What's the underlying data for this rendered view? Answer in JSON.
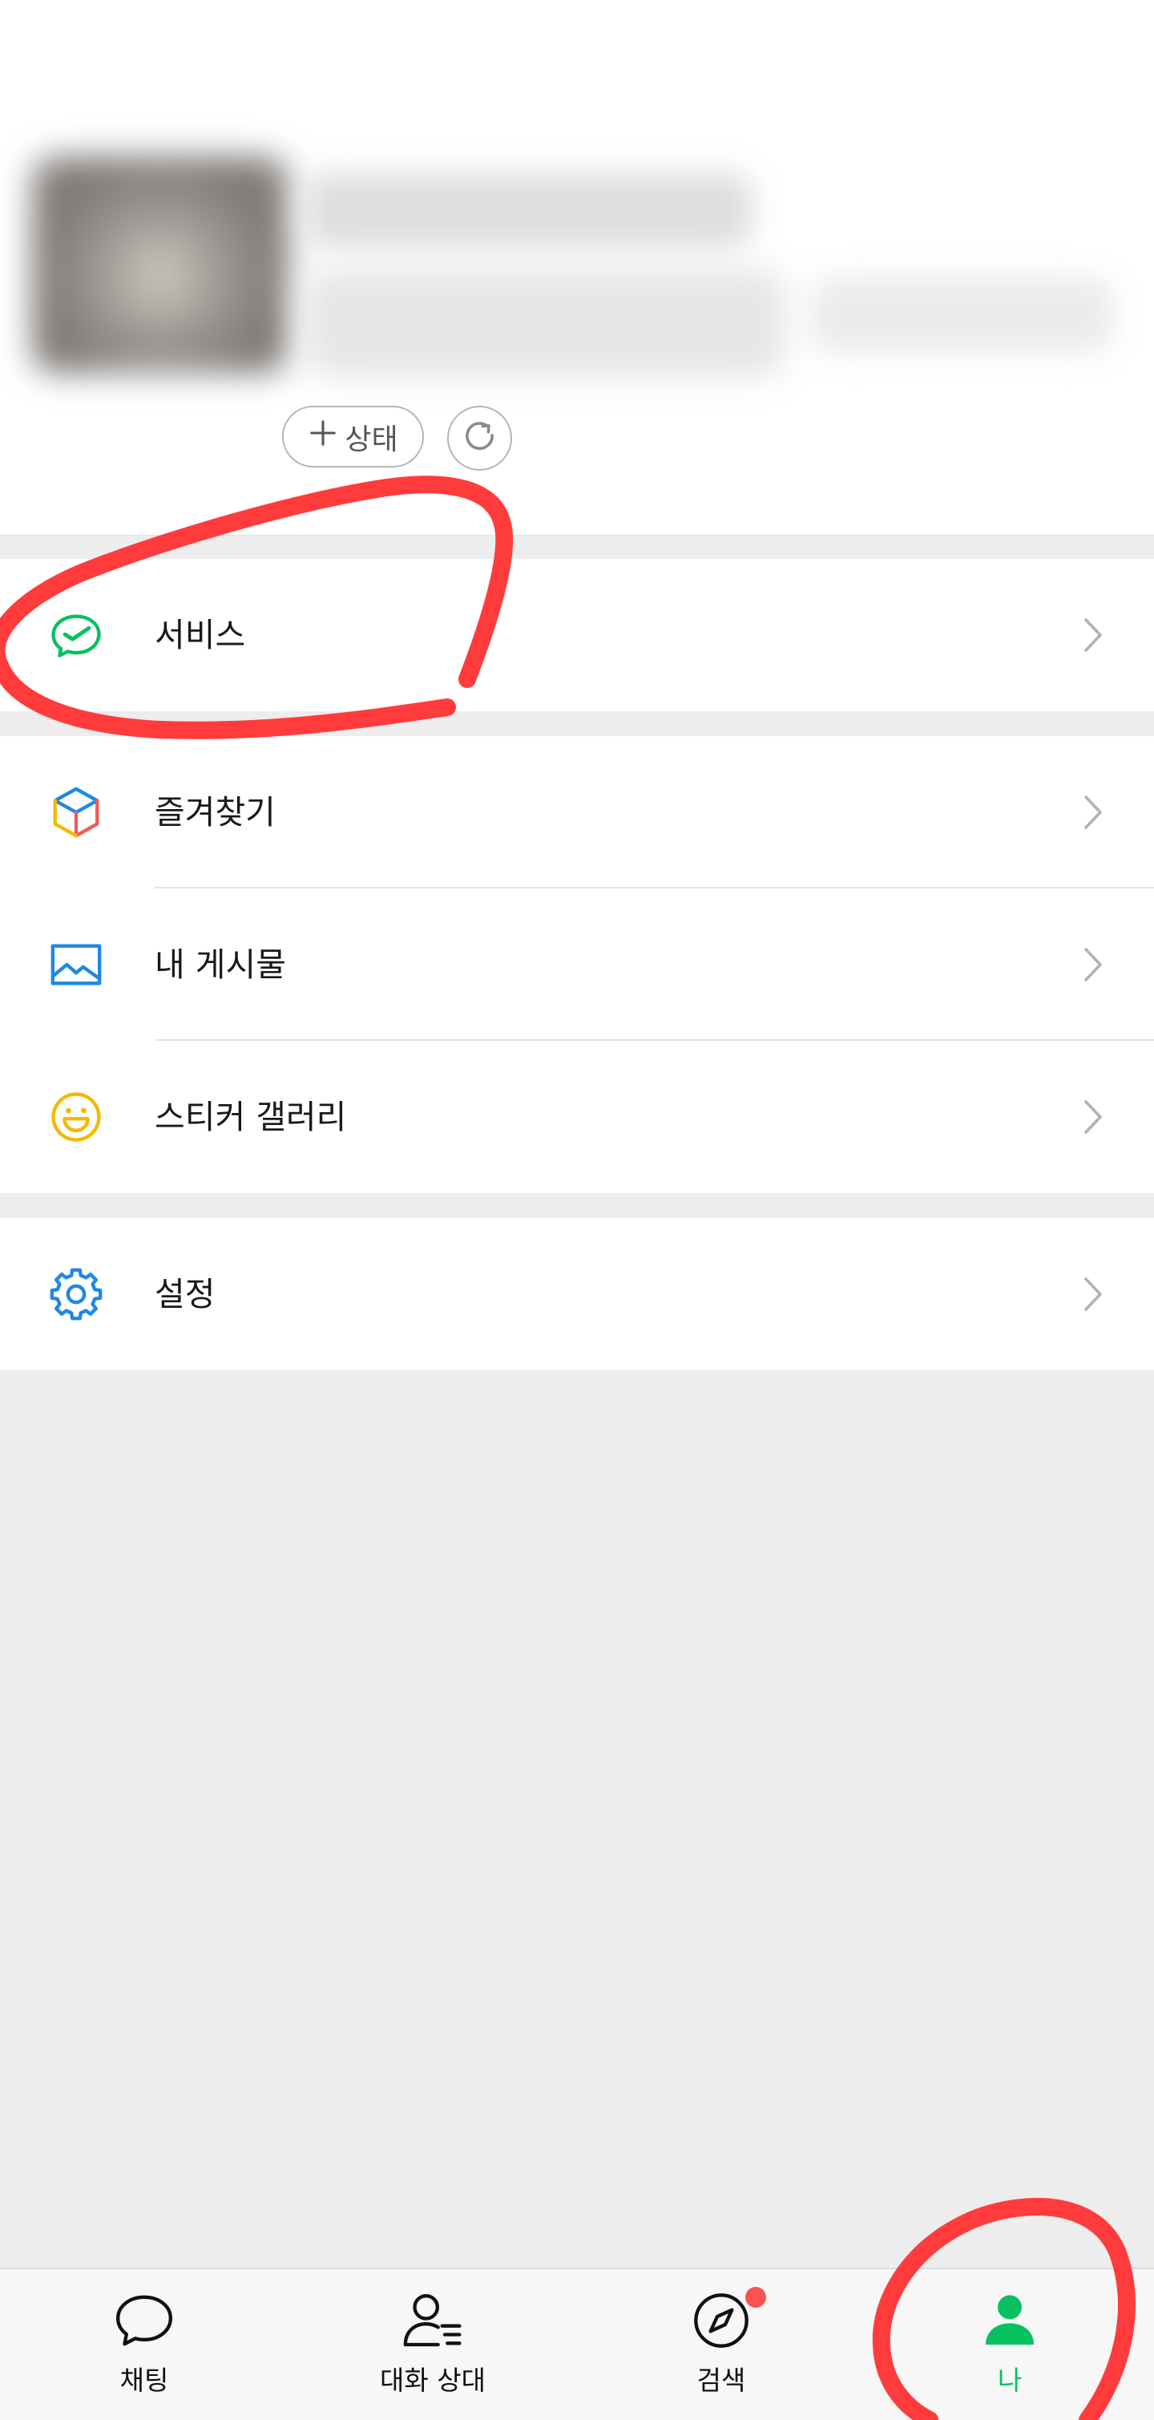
{
  "profile": {
    "avatar_icon": "avatar-blurred",
    "status_button": {
      "label": "상태",
      "icon": "plus-icon"
    },
    "refresh_button": {
      "icon": "refresh-icon"
    }
  },
  "menu": {
    "service": {
      "label": "서비스",
      "icon": "chat-check-icon"
    },
    "favorites": {
      "label": "즐겨찾기",
      "icon": "cube-icon"
    },
    "my_posts": {
      "label": "내 게시물",
      "icon": "picture-icon"
    },
    "sticker_gallery": {
      "label": "스티커 갤러리",
      "icon": "smiley-icon"
    },
    "settings": {
      "label": "설정",
      "icon": "gear-icon"
    }
  },
  "tab_bar": {
    "tabs": [
      {
        "label": "채팅",
        "icon": "chat-bubble-icon",
        "active": false
      },
      {
        "label": "대화 상대",
        "icon": "contacts-icon",
        "active": false
      },
      {
        "label": "검색",
        "icon": "compass-icon",
        "active": false,
        "has_badge": true
      },
      {
        "label": "나",
        "icon": "person-icon",
        "active": true
      }
    ]
  },
  "colors": {
    "accent": "#07c160",
    "badge": "#fa5151",
    "annotation": "#ff3b3b",
    "page_background": "#ededed",
    "icon_blue": "#1e88e5",
    "icon_yellow": "#f5b800",
    "icon_red": "#f05a5a"
  }
}
